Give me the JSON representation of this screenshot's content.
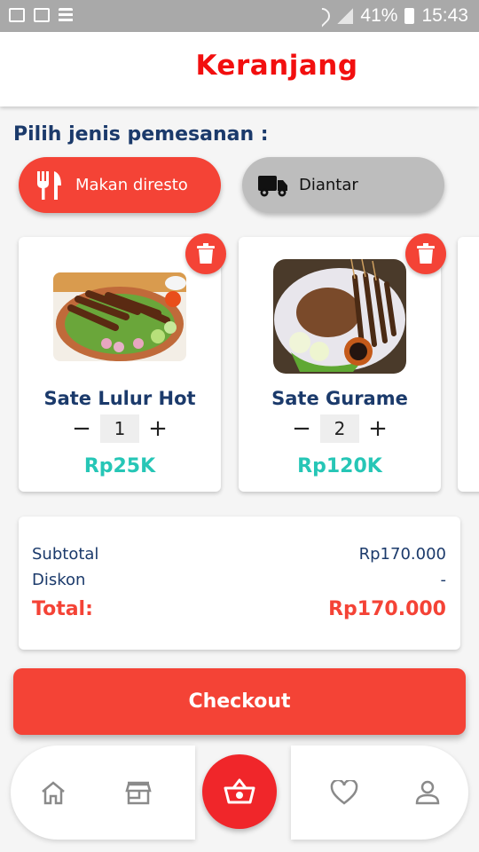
{
  "status_bar": {
    "battery": "41%",
    "time": "15:43"
  },
  "header": {
    "title": "Keranjang"
  },
  "order_type": {
    "label": "Pilih jenis pemesanan :",
    "options": [
      {
        "label": "Makan diresto",
        "icon": "restaurant-icon",
        "selected": true
      },
      {
        "label": "Diantar",
        "icon": "truck-icon",
        "selected": false
      }
    ]
  },
  "cart": {
    "items": [
      {
        "name": "Sate Lulur Hot",
        "qty": "1",
        "price": "Rp25K",
        "minus": "−",
        "plus": "+"
      },
      {
        "name": "Sate Gurame",
        "qty": "2",
        "price": "Rp120K",
        "minus": "−",
        "plus": "+"
      }
    ]
  },
  "summary": {
    "subtotal_label": "Subtotal",
    "subtotal_value": "Rp170.000",
    "discount_label": "Diskon",
    "discount_value": "-",
    "total_label": "Total:",
    "total_value": "Rp170.000"
  },
  "checkout": {
    "label": "Checkout"
  },
  "bottom_nav": {
    "items": [
      "home-icon",
      "store-icon",
      "basket-icon",
      "heart-icon",
      "person-icon"
    ]
  },
  "colors": {
    "accent": "#f44336",
    "title": "#f20f0f",
    "navy": "#1b3a6b",
    "price": "#26c6b6"
  }
}
